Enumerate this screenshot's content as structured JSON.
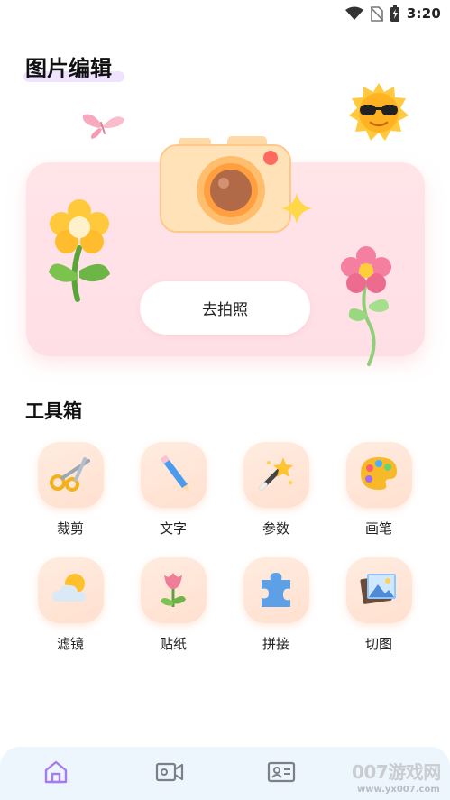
{
  "status_bar": {
    "time": "3:20",
    "icons": [
      "wifi-icon",
      "no-sim-icon",
      "battery-charging-icon"
    ]
  },
  "page": {
    "title": "图片编辑"
  },
  "hero": {
    "button_label": "去拍照",
    "illustrations": [
      "camera-icon",
      "butterfly-icon",
      "sun-with-sunglasses-icon",
      "yellow-flower-icon",
      "pink-flower-icon",
      "sparkle-icon"
    ]
  },
  "toolbox": {
    "title": "工具箱",
    "tools": [
      {
        "label": "裁剪",
        "icon": "scissors-icon"
      },
      {
        "label": "文字",
        "icon": "pencil-icon"
      },
      {
        "label": "参数",
        "icon": "magic-wand-icon"
      },
      {
        "label": "画笔",
        "icon": "palette-icon"
      },
      {
        "label": "滤镜",
        "icon": "sun-cloud-icon"
      },
      {
        "label": "贴纸",
        "icon": "tulip-icon"
      },
      {
        "label": "拼接",
        "icon": "puzzle-icon"
      },
      {
        "label": "切图",
        "icon": "picture-icon"
      }
    ]
  },
  "bottom_nav": {
    "items": [
      {
        "icon": "home-icon",
        "active": true
      },
      {
        "icon": "video-icon",
        "active": false
      },
      {
        "icon": "id-card-icon",
        "active": false
      }
    ],
    "active_color": "#a77bf0",
    "inactive_color": "#7a7f88"
  },
  "watermark": {
    "text": "007游戏网",
    "url": "www.yx007.com"
  },
  "colors": {
    "hero_bg": "#ffe4e8",
    "tile_bg": "#ffe6d6",
    "nav_bg": "#eef6fd",
    "title_highlight": "#efe3ff"
  }
}
